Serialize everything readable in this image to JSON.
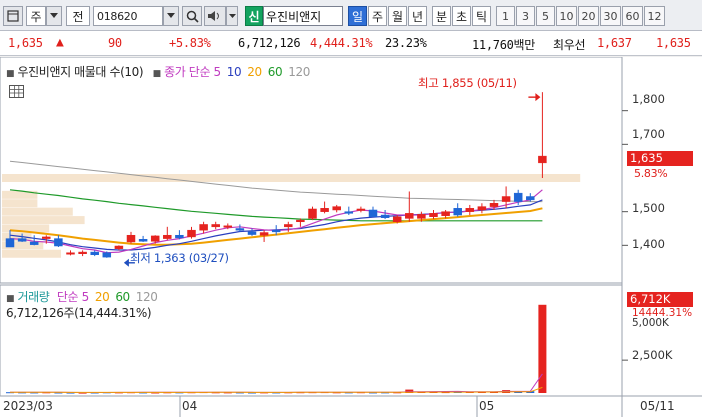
{
  "toolbar": {
    "market_label": "주",
    "prev_label": "전",
    "code": "018620",
    "sin_label": "신",
    "stock_name": "우진비앤지",
    "periods": [
      "일",
      "주",
      "월",
      "년",
      "분",
      "초",
      "틱"
    ],
    "selected_period": "일",
    "intervals": [
      "1",
      "3",
      "5",
      "10",
      "20",
      "30",
      "60",
      "12"
    ]
  },
  "quote": {
    "price": "1,635",
    "change": "90",
    "change_pct": "+5.83%",
    "volume": "6,712,126",
    "volume_ratio": "4,444.31%",
    "turnover": "23.23%",
    "amount": "11,760백만",
    "best_label": "최우선",
    "ask": "1,637",
    "bid": "1,635"
  },
  "price_chart": {
    "title": "우진비앤지 매물대 수(10)",
    "ma_label": "종가 단순",
    "ma_periods": [
      "5",
      "10",
      "20",
      "60",
      "120"
    ],
    "high_note": "최고 1,855 (05/11)",
    "low_note": "최저 1,363 (03/27)",
    "price_badge": "1,635",
    "pct_badge": "5.83%",
    "y_labels": [
      "1,800",
      "1,700",
      "1,500",
      "1,400"
    ]
  },
  "volume_chart": {
    "title": "거래량",
    "ma_label": "단순",
    "ma_periods": [
      "5",
      "20",
      "60",
      "120"
    ],
    "info": "6,712,126주(14,444.31%)",
    "volume_badge": "6,712K",
    "ratio_label": "14444.31%",
    "y_tick_partial": "5,000K",
    "y_labels": [
      "2,500K"
    ]
  },
  "x_labels": [
    "2023/03",
    "04",
    "05",
    "05/11"
  ],
  "colors": {
    "up": "#e5231f",
    "down": "#1f66d6",
    "ma5": "#c03bc0",
    "ma10": "#2a3fbf",
    "ma20": "#f0a000",
    "ma60": "#1f9a2a",
    "ma120": "#9a9a9a"
  },
  "chart_data": {
    "type": "candlestick",
    "ylim": [
      1300,
      1900
    ],
    "candles": [
      {
        "o": 1420,
        "h": 1445,
        "l": 1395,
        "c": 1395
      },
      {
        "o": 1420,
        "h": 1435,
        "l": 1410,
        "c": 1412
      },
      {
        "o": 1410,
        "h": 1430,
        "l": 1400,
        "c": 1402
      },
      {
        "o": 1420,
        "h": 1430,
        "l": 1405,
        "c": 1425
      },
      {
        "o": 1420,
        "h": 1430,
        "l": 1395,
        "c": 1398
      },
      {
        "o": 1375,
        "h": 1385,
        "l": 1370,
        "c": 1378
      },
      {
        "o": 1375,
        "h": 1385,
        "l": 1368,
        "c": 1380
      },
      {
        "o": 1380,
        "h": 1385,
        "l": 1368,
        "c": 1372
      },
      {
        "o": 1378,
        "h": 1382,
        "l": 1363,
        "c": 1365
      },
      {
        "o": 1390,
        "h": 1400,
        "l": 1385,
        "c": 1398
      },
      {
        "o": 1410,
        "h": 1440,
        "l": 1405,
        "c": 1430
      },
      {
        "o": 1418,
        "h": 1428,
        "l": 1410,
        "c": 1412
      },
      {
        "o": 1412,
        "h": 1430,
        "l": 1405,
        "c": 1428
      },
      {
        "o": 1420,
        "h": 1455,
        "l": 1415,
        "c": 1430
      },
      {
        "o": 1430,
        "h": 1445,
        "l": 1418,
        "c": 1422
      },
      {
        "o": 1425,
        "h": 1455,
        "l": 1420,
        "c": 1445
      },
      {
        "o": 1445,
        "h": 1470,
        "l": 1435,
        "c": 1462
      },
      {
        "o": 1455,
        "h": 1470,
        "l": 1448,
        "c": 1462
      },
      {
        "o": 1455,
        "h": 1465,
        "l": 1448,
        "c": 1458
      },
      {
        "o": 1450,
        "h": 1462,
        "l": 1440,
        "c": 1445
      },
      {
        "o": 1440,
        "h": 1450,
        "l": 1428,
        "c": 1432
      },
      {
        "o": 1430,
        "h": 1445,
        "l": 1410,
        "c": 1438
      },
      {
        "o": 1445,
        "h": 1460,
        "l": 1430,
        "c": 1440
      },
      {
        "o": 1455,
        "h": 1470,
        "l": 1440,
        "c": 1462
      },
      {
        "o": 1470,
        "h": 1480,
        "l": 1455,
        "c": 1475
      },
      {
        "o": 1480,
        "h": 1515,
        "l": 1475,
        "c": 1508
      },
      {
        "o": 1500,
        "h": 1530,
        "l": 1495,
        "c": 1510
      },
      {
        "o": 1505,
        "h": 1520,
        "l": 1498,
        "c": 1515
      },
      {
        "o": 1500,
        "h": 1515,
        "l": 1490,
        "c": 1495
      },
      {
        "o": 1505,
        "h": 1515,
        "l": 1498,
        "c": 1508
      },
      {
        "o": 1505,
        "h": 1515,
        "l": 1485,
        "c": 1485
      },
      {
        "o": 1490,
        "h": 1505,
        "l": 1478,
        "c": 1482
      },
      {
        "o": 1470,
        "h": 1490,
        "l": 1465,
        "c": 1485
      },
      {
        "o": 1480,
        "h": 1560,
        "l": 1470,
        "c": 1495
      },
      {
        "o": 1480,
        "h": 1500,
        "l": 1470,
        "c": 1492
      },
      {
        "o": 1485,
        "h": 1505,
        "l": 1478,
        "c": 1495
      },
      {
        "o": 1488,
        "h": 1505,
        "l": 1480,
        "c": 1500
      },
      {
        "o": 1510,
        "h": 1525,
        "l": 1485,
        "c": 1490
      },
      {
        "o": 1500,
        "h": 1520,
        "l": 1490,
        "c": 1510
      },
      {
        "o": 1505,
        "h": 1525,
        "l": 1495,
        "c": 1515
      },
      {
        "o": 1515,
        "h": 1535,
        "l": 1505,
        "c": 1525
      },
      {
        "o": 1530,
        "h": 1575,
        "l": 1510,
        "c": 1545
      },
      {
        "o": 1555,
        "h": 1565,
        "l": 1520,
        "c": 1530
      },
      {
        "o": 1545,
        "h": 1555,
        "l": 1530,
        "c": 1535
      },
      {
        "o": 1645,
        "h": 1855,
        "l": 1600,
        "c": 1665
      }
    ],
    "ma5_points": [
      1420,
      1418,
      1412,
      1410,
      1406,
      1398,
      1390,
      1386,
      1378,
      1380,
      1388,
      1398,
      1408,
      1415,
      1420,
      1428,
      1436,
      1445,
      1452,
      1455,
      1450,
      1446,
      1444,
      1446,
      1452,
      1465,
      1478,
      1490,
      1498,
      1505,
      1502,
      1496,
      1490,
      1490,
      1490,
      1494,
      1498,
      1498,
      1502,
      1506,
      1512,
      1520,
      1528,
      1535,
      1565
    ],
    "ma10_points": [
      1430,
      1426,
      1421,
      1416,
      1410,
      1402,
      1396,
      1392,
      1388,
      1386,
      1386,
      1389,
      1394,
      1400,
      1405,
      1412,
      1420,
      1428,
      1435,
      1441,
      1443,
      1445,
      1446,
      1448,
      1450,
      1456,
      1462,
      1470,
      1476,
      1481,
      1484,
      1486,
      1488,
      1490,
      1492,
      1494,
      1497,
      1499,
      1502,
      1504,
      1507,
      1511,
      1516,
      1520,
      1535
    ],
    "ma20_points": [
      1445,
      1442,
      1438,
      1434,
      1430,
      1425,
      1420,
      1416,
      1412,
      1408,
      1405,
      1403,
      1402,
      1402,
      1403,
      1405,
      1408,
      1412,
      1416,
      1420,
      1424,
      1428,
      1432,
      1436,
      1440,
      1444,
      1448,
      1452,
      1456,
      1460,
      1463,
      1466,
      1469,
      1472,
      1475,
      1478,
      1481,
      1484,
      1487,
      1490,
      1493,
      1496,
      1499,
      1502,
      1510
    ],
    "ma60_points": [
      1565,
      1561,
      1556,
      1552,
      1548,
      1543,
      1538,
      1534,
      1530,
      1525,
      1521,
      1517,
      1513,
      1509,
      1505,
      1501,
      1498,
      1495,
      1492,
      1489,
      1486,
      1484,
      1482,
      1480,
      1478,
      1477,
      1476,
      1475,
      1474,
      1473,
      1473,
      1473,
      1473,
      1473,
      1473,
      1473,
      1473,
      1473,
      1473,
      1473,
      1473,
      1473,
      1473,
      1473,
      1473
    ],
    "ma120_points": [
      1650,
      1646,
      1642,
      1638,
      1634,
      1630,
      1626,
      1622,
      1618,
      1614,
      1610,
      1606,
      1602,
      1598,
      1594,
      1590,
      1586,
      1582,
      1578,
      1574,
      1570,
      1567,
      1564,
      1561,
      1558,
      1556,
      1554,
      1552,
      1550,
      1548,
      1546,
      1544,
      1542,
      1540,
      1539,
      1538,
      1537,
      1536,
      1535,
      1534,
      1533,
      1532,
      1531,
      1530,
      1530
    ],
    "volume_profile": [
      {
        "price": 1600,
        "width": 0.98
      },
      {
        "price": 1550,
        "width": 0.06
      },
      {
        "price": 1525,
        "width": 0.06
      },
      {
        "price": 1500,
        "width": 0.12
      },
      {
        "price": 1475,
        "width": 0.14
      },
      {
        "price": 1450,
        "width": 0.08
      },
      {
        "price": 1425,
        "width": 0.05
      },
      {
        "price": 1400,
        "width": 0.07
      },
      {
        "price": 1375,
        "width": 0.1
      }
    ],
    "volume": {
      "ylim": [
        0,
        7000
      ],
      "values": [
        60,
        50,
        45,
        55,
        40,
        35,
        30,
        40,
        55,
        50,
        60,
        45,
        40,
        55,
        50,
        60,
        70,
        55,
        50,
        45,
        40,
        50,
        45,
        55,
        60,
        65,
        70,
        55,
        50,
        60,
        45,
        50,
        55,
        260,
        80,
        90,
        70,
        120,
        80,
        90,
        110,
        220,
        90,
        140,
        6712
      ],
      "up": [
        false,
        false,
        false,
        true,
        false,
        false,
        true,
        false,
        false,
        true,
        true,
        false,
        true,
        true,
        false,
        true,
        true,
        true,
        true,
        false,
        false,
        true,
        false,
        true,
        true,
        true,
        true,
        true,
        false,
        true,
        false,
        false,
        true,
        true,
        true,
        true,
        true,
        false,
        true,
        true,
        true,
        true,
        false,
        false,
        true
      ]
    }
  }
}
